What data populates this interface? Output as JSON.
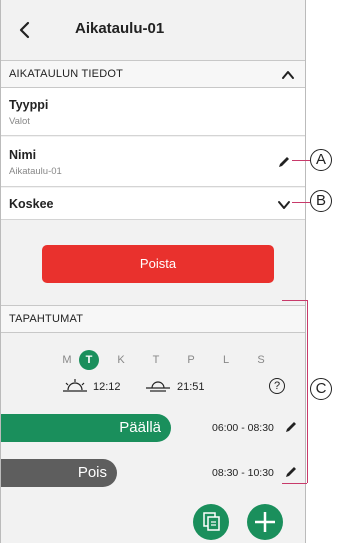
{
  "header": {
    "title": "Aikataulu-01"
  },
  "details": {
    "section_label": "AIKATAULUN TIEDOT",
    "type": {
      "label": "Tyyppi",
      "value": "Valot"
    },
    "name": {
      "label": "Nimi",
      "value": "Aikataulu-01"
    },
    "applies": {
      "label": "Koskee"
    }
  },
  "delete_label": "Poista",
  "events": {
    "section_label": "TAPAHTUMAT",
    "days": [
      "M",
      "T",
      "K",
      "T",
      "P",
      "L",
      "S"
    ],
    "selected_day_index": 1,
    "sunrise": "12:12",
    "sunset": "21:51",
    "help": "?",
    "items": [
      {
        "label": "Päällä",
        "time": "06:00 - 08:30",
        "color": "#1a8f5c"
      },
      {
        "label": "Pois",
        "time": "08:30 - 10:30",
        "color": "#5e5e5e"
      }
    ]
  },
  "callouts": [
    "A",
    "B",
    "C"
  ],
  "colors": {
    "accent": "#1a8f5c",
    "danger": "#e9312d",
    "callout_line": "#c83a6a"
  }
}
